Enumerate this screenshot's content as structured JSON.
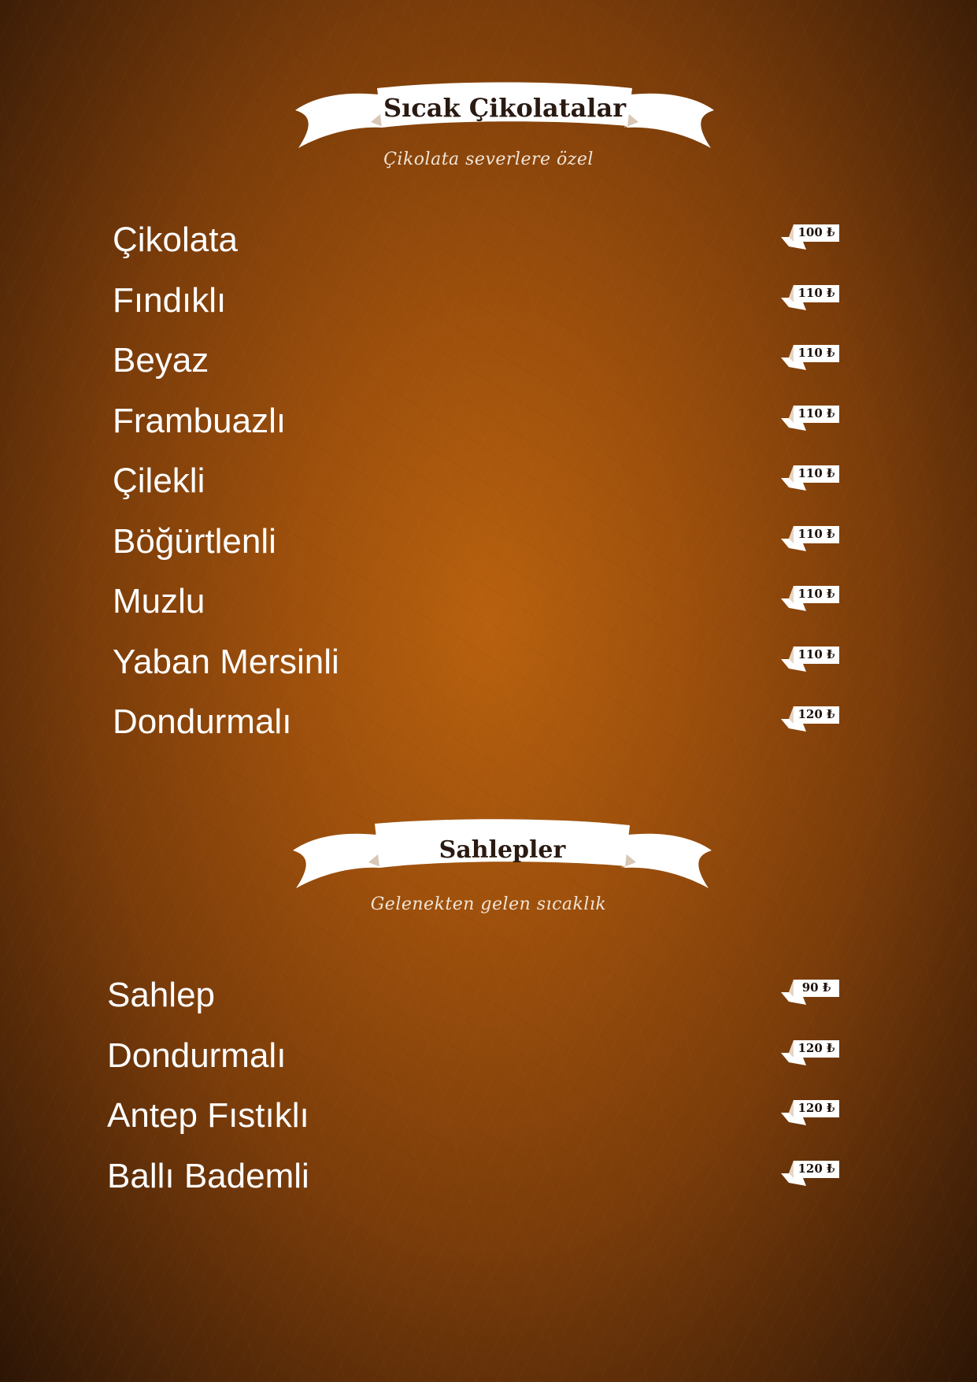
{
  "sections": [
    {
      "title": "Sıcak Çikolatalar",
      "tagline": "Çikolata severlere özel",
      "items": [
        {
          "name": "Çikolata",
          "price": "100 ₺"
        },
        {
          "name": "Fındıklı",
          "price": "110 ₺"
        },
        {
          "name": "Beyaz",
          "price": "110 ₺"
        },
        {
          "name": "Frambuazlı",
          "price": "110 ₺"
        },
        {
          "name": "Çilekli",
          "price": "110 ₺"
        },
        {
          "name": "Böğürtlenli",
          "price": "110 ₺"
        },
        {
          "name": "Muzlu",
          "price": "110 ₺"
        },
        {
          "name": "Yaban Mersinli",
          "price": "110 ₺"
        },
        {
          "name": "Dondurmalı",
          "price": "120 ₺"
        }
      ]
    },
    {
      "title": "Sahlepler",
      "tagline": "Gelenekten gelen sıcaklık",
      "items": [
        {
          "name": "Sahlep",
          "price": "90 ₺"
        },
        {
          "name": "Dondurmalı",
          "price": "120 ₺"
        },
        {
          "name": "Antep Fıstıklı",
          "price": "120 ₺"
        },
        {
          "name": "Ballı Bademli",
          "price": "120 ₺"
        }
      ]
    }
  ],
  "colors": {
    "background": "#9c4f0c",
    "text": "#ffffff",
    "banner": "#ffffff",
    "banner_text": "#2a1a12"
  },
  "icons": [
    "ribbon-banner-icon",
    "price-tag-icon"
  ]
}
